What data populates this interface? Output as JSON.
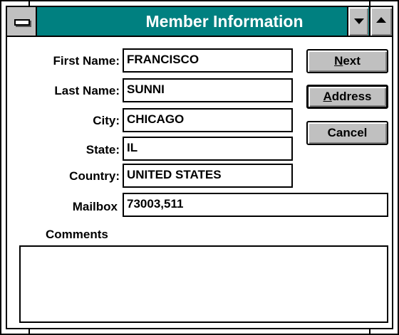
{
  "window": {
    "title": "Member Information"
  },
  "form": {
    "first_name": {
      "label": "First Name:",
      "value": "FRANCISCO"
    },
    "last_name": {
      "label": "Last Name:",
      "value": "SUNNI"
    },
    "city": {
      "label": "City:",
      "value": "CHICAGO"
    },
    "state": {
      "label": "State:",
      "value": "IL"
    },
    "country": {
      "label": "Country:",
      "value": "UNITED STATES"
    },
    "mailbox": {
      "label": "Mailbox",
      "value": "73003,511"
    },
    "comments": {
      "label": "Comments",
      "value": ""
    }
  },
  "buttons": {
    "next": {
      "mnemonic": "N",
      "rest": "ext"
    },
    "address": {
      "mnemonic": "A",
      "rest": "ddress"
    },
    "cancel": {
      "label": "Cancel"
    }
  },
  "colors": {
    "titlebar": "#008080",
    "button_face": "#c0c0c0"
  },
  "icons": {
    "system_menu": "system-menu-icon",
    "minimize": "minimize-triangle-icon",
    "maximize": "maximize-triangle-icon"
  }
}
